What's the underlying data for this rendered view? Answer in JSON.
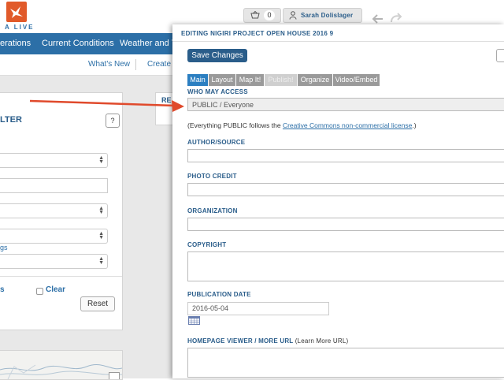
{
  "header": {
    "logo_text": "A LIVE",
    "cart_count": "0",
    "user_name": "Sarah Dolislager"
  },
  "nav": {
    "items": [
      "erations",
      "Current Conditions",
      "Weather and Tide"
    ]
  },
  "subnav": {
    "items": [
      "What's New",
      "Create D"
    ]
  },
  "filter": {
    "title": "LTER",
    "help_label": "?",
    "blue_text": "gs",
    "s_label": "s",
    "clear_label": "Clear",
    "reset_label": "Reset"
  },
  "middle": {
    "label": "RE"
  },
  "editor": {
    "title": "EDITING NIGIRI PROJECT OPEN HOUSE 2016 9",
    "save_label": "Save Changes",
    "tabs": [
      {
        "label": "Main",
        "state": "active"
      },
      {
        "label": "Layout",
        "state": "normal"
      },
      {
        "label": "Map It!",
        "state": "normal"
      },
      {
        "label": "Publish!",
        "state": "disabled"
      },
      {
        "label": "Organize",
        "state": "normal"
      },
      {
        "label": "Video/Embed",
        "state": "normal"
      }
    ],
    "who_may_access_label": "WHO MAY ACCESS",
    "access_value": "PUBLIC / Everyone",
    "cc_note_prefix": "(Everything PUBLIC follows the ",
    "cc_note_link": "Creative Commons non-commercial license",
    "cc_note_suffix": ".)",
    "author_label": "AUTHOR/SOURCE",
    "author_value": "",
    "photo_credit_label": "PHOTO CREDIT",
    "photo_credit_value": "",
    "organization_label": "ORGANIZATION",
    "organization_value": "",
    "copyright_label": "COPYRIGHT",
    "copyright_value": "",
    "publication_date_label": "PUBLICATION DATE",
    "publication_date_value": "2016-05-04",
    "homepage_label": "HOMEPAGE VIEWER / MORE URL",
    "homepage_note": "(Learn More URL)",
    "homepage_value": ""
  },
  "colors": {
    "brand_blue": "#2c6fa7",
    "heading_blue": "#2a5d8a",
    "active_tab": "#2c7fc1",
    "logo_orange": "#e15a2a",
    "annotation_arrow": "#e04a2c"
  },
  "icons": [
    "logo-bird-icon",
    "basket-icon",
    "user-icon",
    "undo-icon",
    "redo-icon",
    "calendar-icon",
    "expand-icon",
    "annotation-arrow-icon"
  ]
}
